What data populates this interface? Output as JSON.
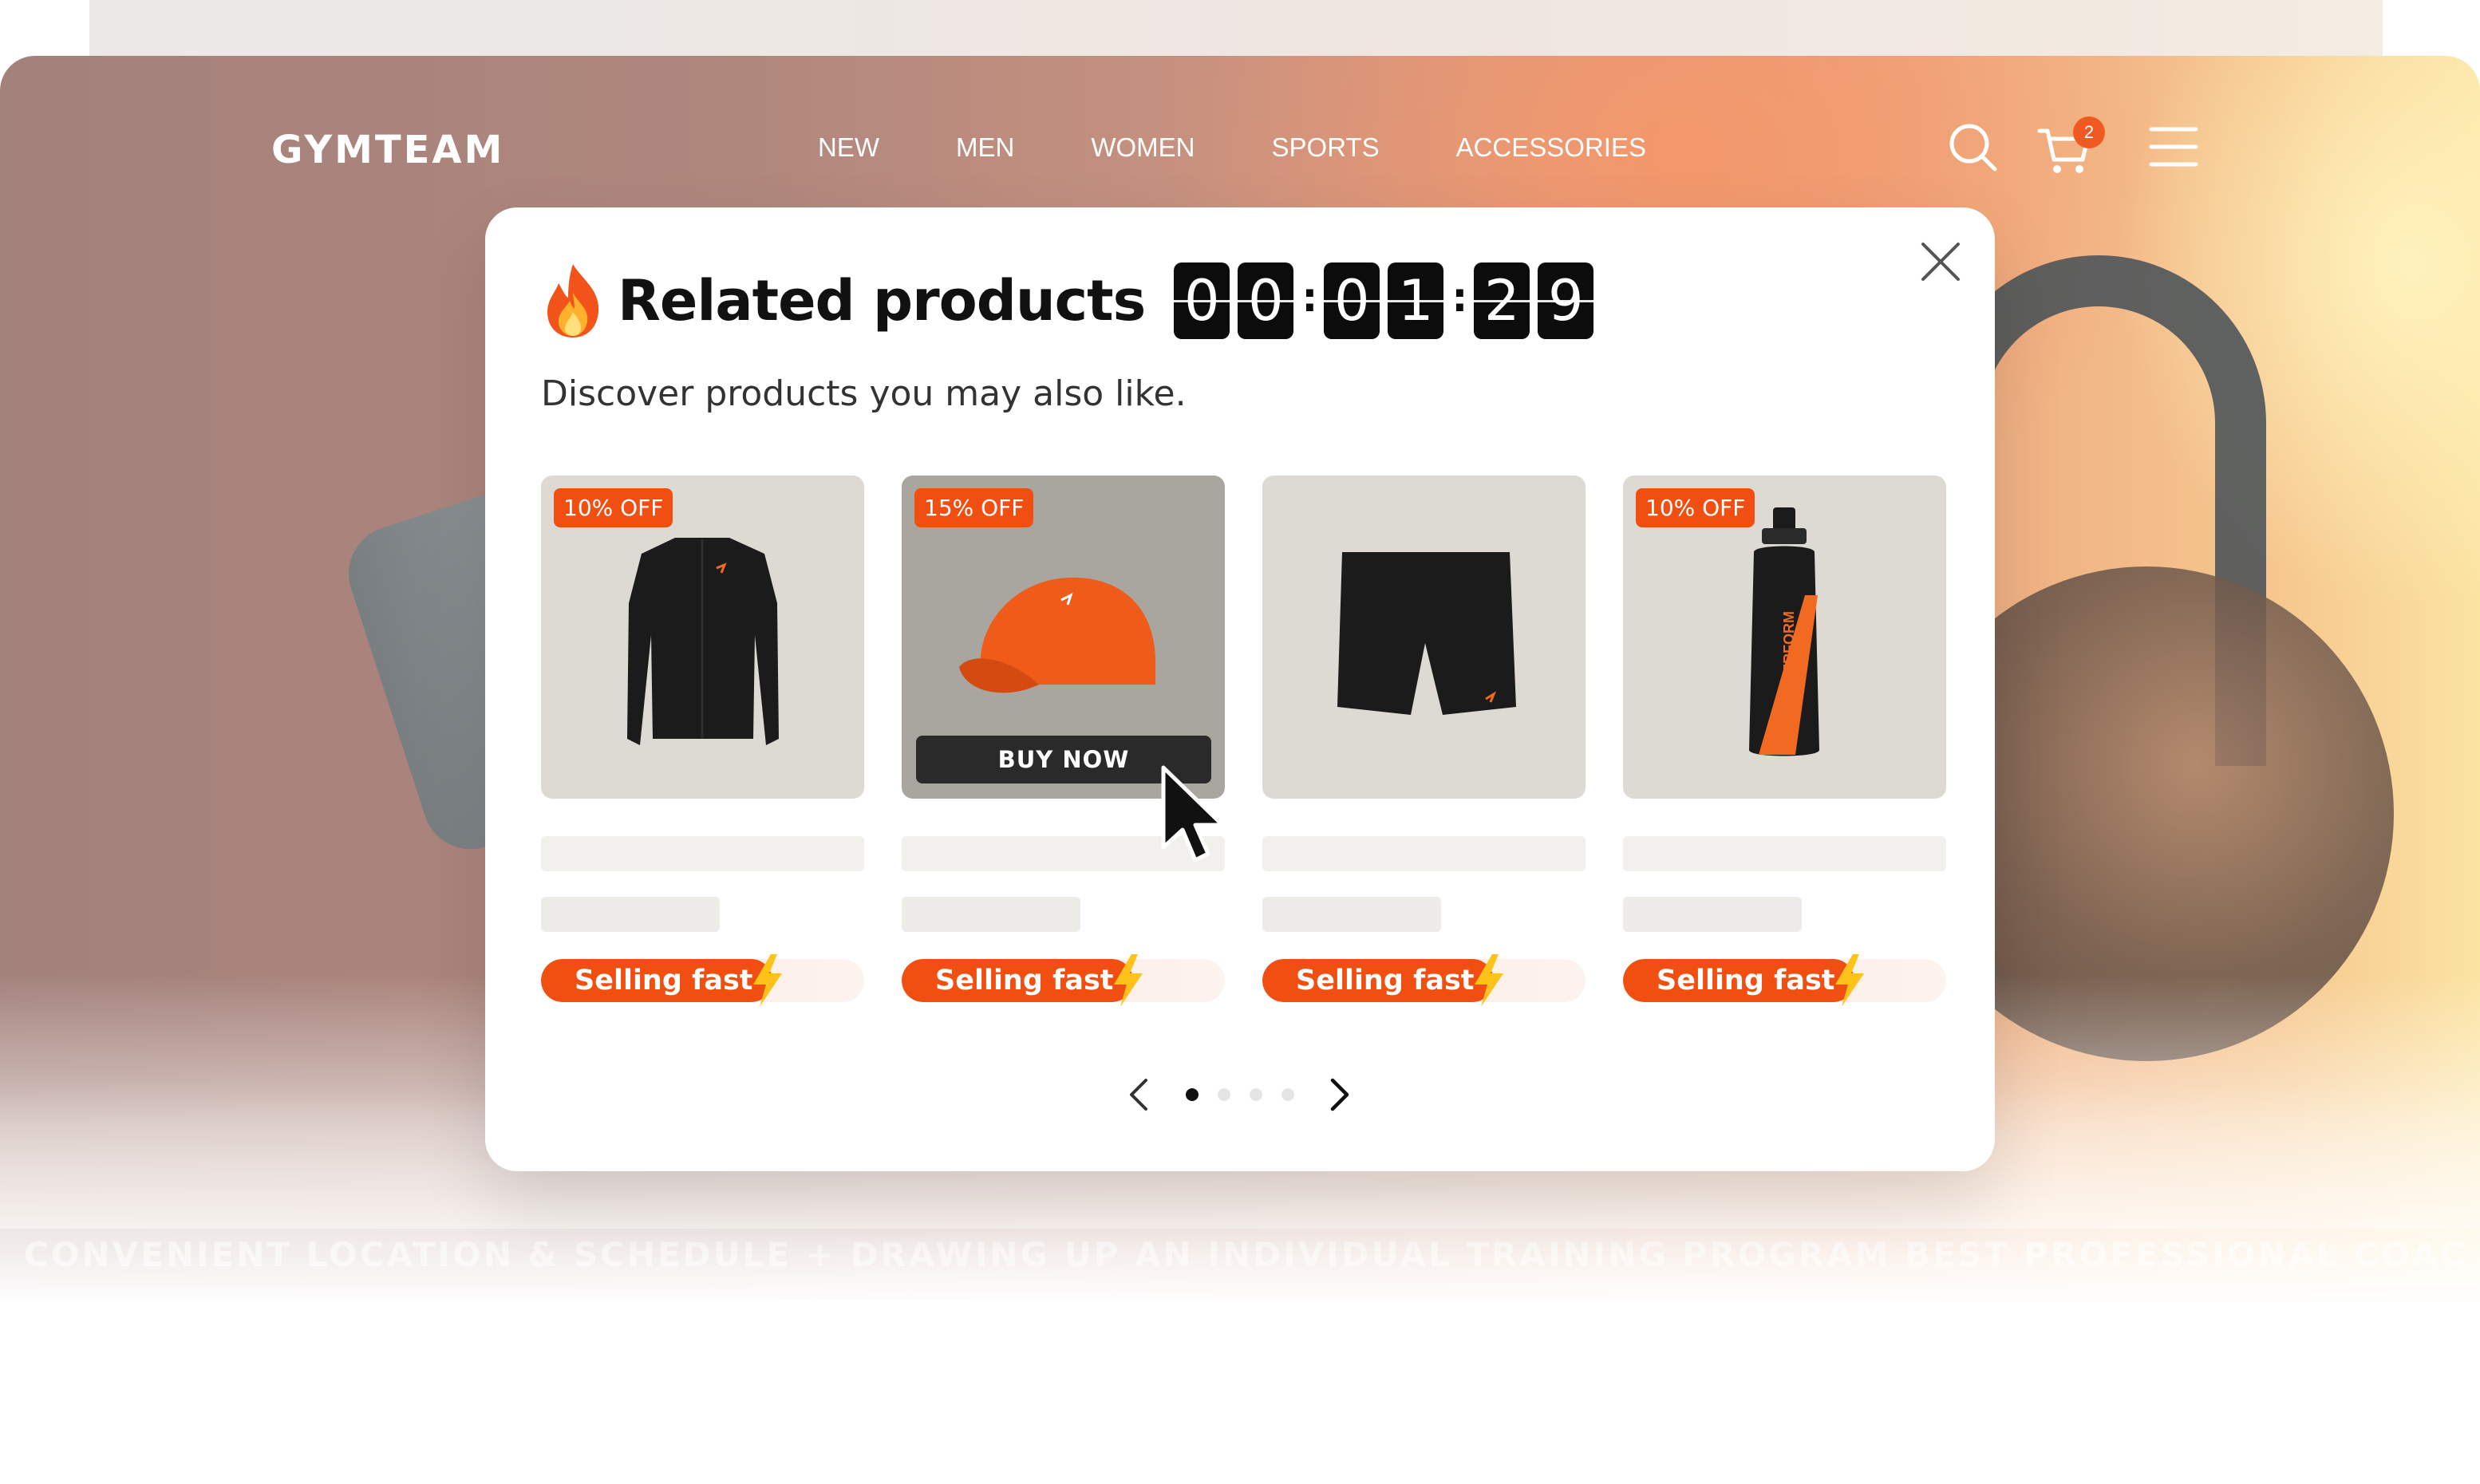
{
  "brand": {
    "logo": "GYMTEAM"
  },
  "nav": {
    "items": [
      {
        "label": "NEW"
      },
      {
        "label": "MEN"
      },
      {
        "label": "WOMEN"
      },
      {
        "label": "SPORTS"
      },
      {
        "label": "ACCESSORIES"
      }
    ],
    "cart_count": "2",
    "icons": [
      "search-icon",
      "cart-icon",
      "menu-icon"
    ]
  },
  "modal": {
    "title": "Related products",
    "subtitle": "Discover products you may also like.",
    "timer": {
      "digits": [
        "0",
        "0",
        "0",
        "1",
        "2",
        "9"
      ],
      "separator": ":"
    },
    "products": [
      {
        "discount": "10% OFF",
        "image": "zip-top-icon",
        "badge": "Selling fast"
      },
      {
        "discount": "15% OFF",
        "image": "cap-icon",
        "badge": "Selling fast",
        "action": "BUY NOW"
      },
      {
        "discount": "",
        "image": "shorts-icon",
        "badge": "Selling fast"
      },
      {
        "discount": "10% OFF",
        "image": "bottle-icon",
        "badge": "Selling fast",
        "bottle_text": "PERFORM"
      }
    ],
    "pagination": {
      "pages": 4,
      "active": 1
    }
  },
  "marquee": {
    "text": "CONVENIENT LOCATION & SCHEDULE  +  DRAWING UP AN INDIVIDUAL TRAINING PROGRAM BEST PROFESSIONAL COACHES"
  },
  "colors": {
    "accent": "#f14f12",
    "dark": "#0c0c0c",
    "card_bg": "#dcdad3"
  }
}
